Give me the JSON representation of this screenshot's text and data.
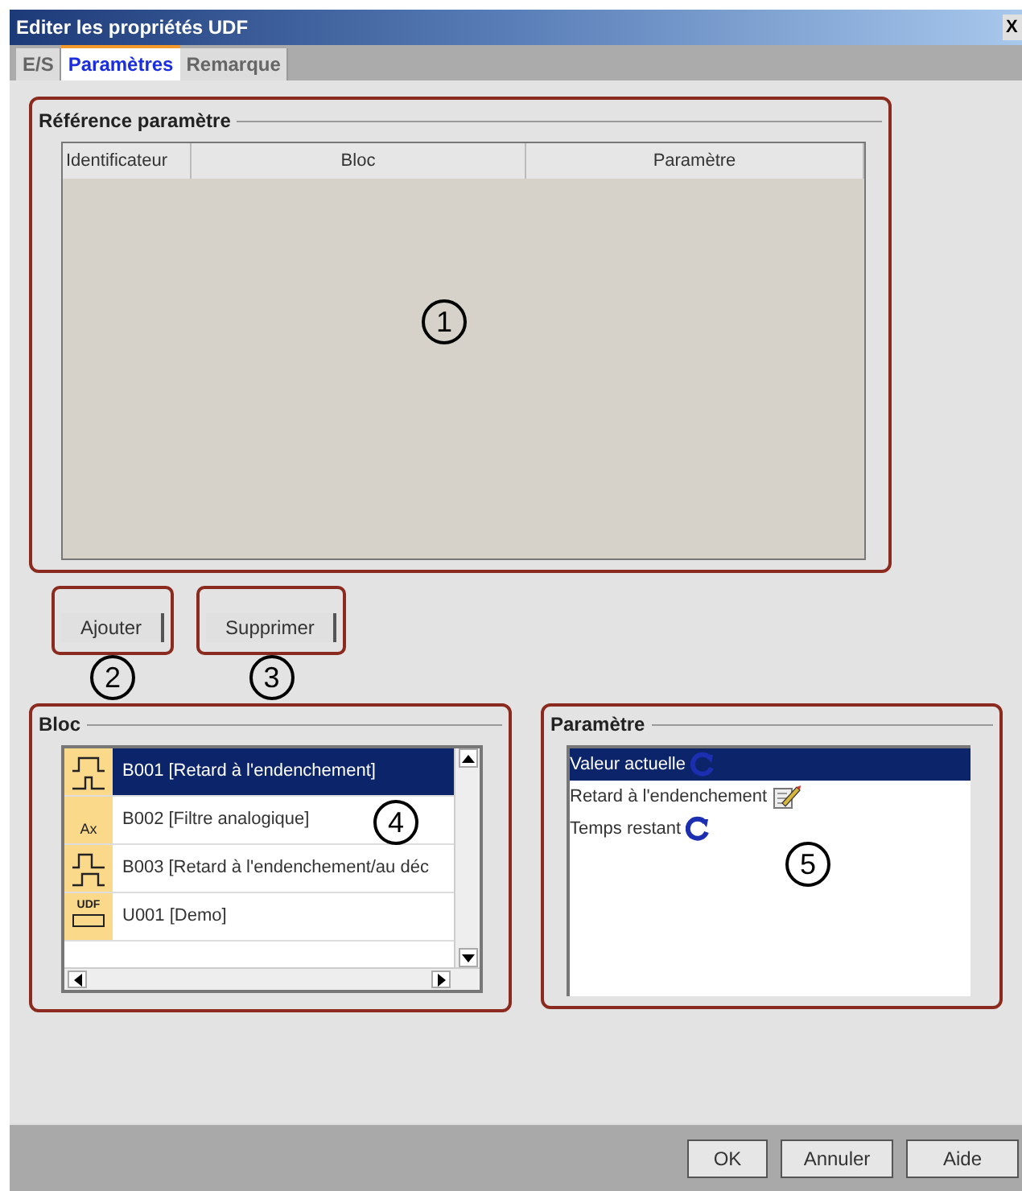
{
  "window": {
    "title": "Editer les propriétés UDF",
    "close": "X"
  },
  "tabs": [
    {
      "label": "E/S",
      "selected": false
    },
    {
      "label": "Paramètres",
      "selected": true
    },
    {
      "label": "Remarque",
      "selected": false
    }
  ],
  "reference_panel": {
    "title": "Référence paramètre",
    "columns": [
      "Identificateur",
      "Bloc",
      "Paramètre"
    ],
    "callout": "1"
  },
  "actions": [
    {
      "label": "Ajouter",
      "callout": "2"
    },
    {
      "label": "Supprimer",
      "callout": "3"
    }
  ],
  "bloc_panel": {
    "title": "Bloc",
    "callout": "4",
    "items": [
      {
        "label": "B001 [Retard à l'endenchement]",
        "kind": "on-delay",
        "selected": true
      },
      {
        "label": "B002 [Filtre analogique]",
        "kind": "analog-filter",
        "icon_label": "Ax",
        "selected": false
      },
      {
        "label": "B003 [Retard à l'endenchement/au déc",
        "kind": "on-off-delay",
        "selected": false
      },
      {
        "label": "U001 [Demo]",
        "kind": "udf",
        "icon_label": "UDF",
        "selected": false
      }
    ]
  },
  "parametre_panel": {
    "title": "Paramètre",
    "callout": "5",
    "items": [
      {
        "label": "Valeur actuelle",
        "kind": "refresh",
        "selected": true
      },
      {
        "label": "Retard à l'endenchement",
        "kind": "edit",
        "selected": false
      },
      {
        "label": "Temps restant",
        "kind": "refresh",
        "selected": false
      }
    ]
  },
  "footer_buttons": [
    "OK",
    "Annuler",
    "Aide"
  ]
}
